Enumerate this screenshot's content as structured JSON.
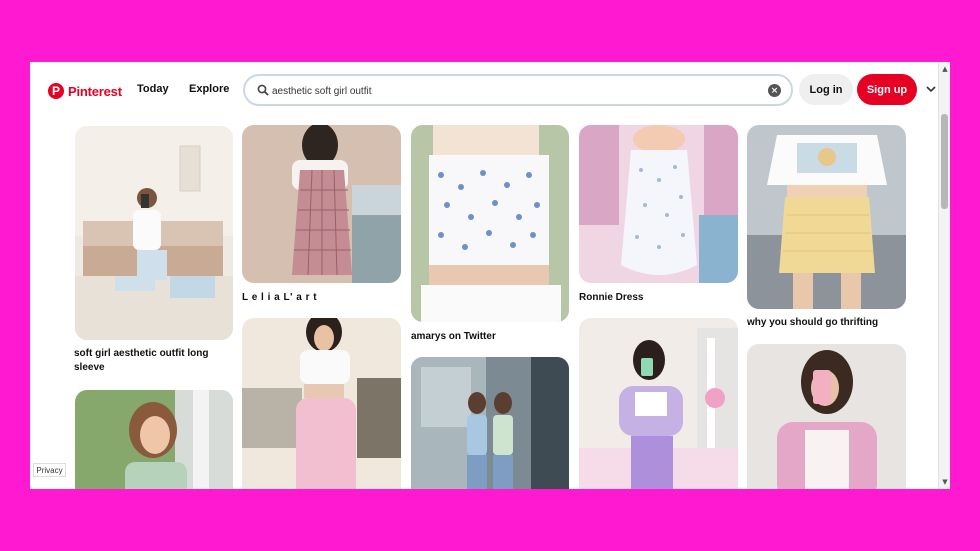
{
  "header": {
    "logo_text": "Pinterest",
    "nav": {
      "today": "Today",
      "explore": "Explore"
    },
    "search": {
      "value": "aesthetic soft girl outfit",
      "placeholder": "Search"
    },
    "login_label": "Log in",
    "signup_label": "Sign up"
  },
  "pins": [
    {
      "caption": "soft girl aesthetic outfit long sleeve"
    },
    {
      "caption": ""
    },
    {
      "caption": "L e l i a L' a r t"
    },
    {
      "caption": ""
    },
    {
      "caption": "amarys on Twitter"
    },
    {
      "caption": ""
    },
    {
      "caption": "Ronnie Dress"
    },
    {
      "caption": ""
    },
    {
      "caption": "why you should go thrifting"
    },
    {
      "caption": ""
    }
  ],
  "footer": {
    "privacy_label": "Privacy"
  },
  "colors": {
    "brand": "#e60023",
    "background": "#ff19d0"
  }
}
